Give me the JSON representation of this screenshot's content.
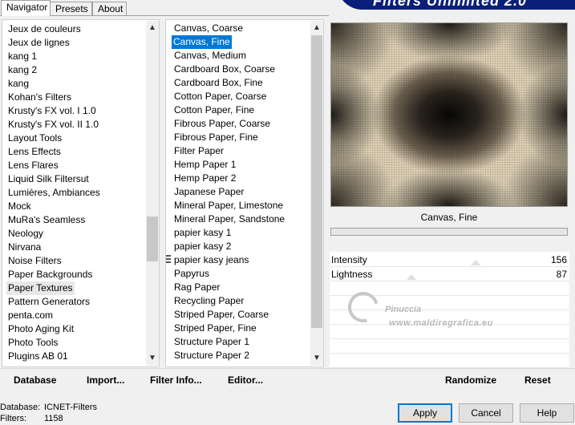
{
  "tabs": [
    "Navigator",
    "Presets",
    "About"
  ],
  "banner_title": "Filters Unlimited 2.0",
  "categories": [
    "Jeux de couleurs",
    "Jeux de lignes",
    "kang 1",
    "kang 2",
    "kang",
    "Kohan's Filters",
    "Krusty's FX vol. I 1.0",
    "Krusty's FX vol. II 1.0",
    "Layout Tools",
    "Lens Effects",
    "Lens Flares",
    "Liquid Silk Filtersut",
    "Lumières, Ambiances",
    "Mock",
    "MuRa's Seamless",
    "Neology",
    "Nirvana",
    "Noise Filters",
    "Paper Backgrounds",
    "Paper Textures",
    "Pattern Generators",
    "penta.com",
    "Photo Aging Kit",
    "Photo Tools",
    "Plugins AB 01"
  ],
  "selected_category": "Paper Textures",
  "filters": [
    "Canvas, Coarse",
    "Canvas, Fine",
    "Canvas, Medium",
    "Cardboard Box, Coarse",
    "Cardboard Box, Fine",
    "Cotton Paper, Coarse",
    "Cotton Paper, Fine",
    "Fibrous Paper, Coarse",
    "Fibrous Paper, Fine",
    "Filter Paper",
    "Hemp Paper 1",
    "Hemp Paper 2",
    "Japanese Paper",
    "Mineral Paper, Limestone",
    "Mineral Paper, Sandstone",
    "papier kasy 1",
    "papier kasy 2",
    "papier kasy jeans",
    "Papyrus",
    "Rag Paper",
    "Recycling Paper",
    "Striped Paper, Coarse",
    "Striped Paper, Fine",
    "Structure Paper 1",
    "Structure Paper 2"
  ],
  "selected_filter": "Canvas, Fine",
  "preview_label": "Canvas, Fine",
  "progress_fraction": 0.0,
  "params": [
    {
      "name": "Intensity",
      "value": "156"
    },
    {
      "name": "Lightness",
      "value": "87"
    }
  ],
  "watermark": {
    "line1": "Pinuccia",
    "line2": "www.maldiregrafica.eu"
  },
  "toolbar": {
    "database": "Database",
    "import": "Import...",
    "filter_info": "Filter Info...",
    "editor": "Editor...",
    "randomize": "Randomize",
    "reset": "Reset"
  },
  "status": {
    "database_label": "Database:",
    "database_value": "ICNET-Filters",
    "filters_label": "Filters:",
    "filters_value": "1158"
  },
  "buttons": {
    "apply": "Apply",
    "cancel": "Cancel",
    "help": "Help"
  },
  "colors": {
    "selection": "#0078d7",
    "banner": "#0a1f7a",
    "progress": "#06b025"
  }
}
